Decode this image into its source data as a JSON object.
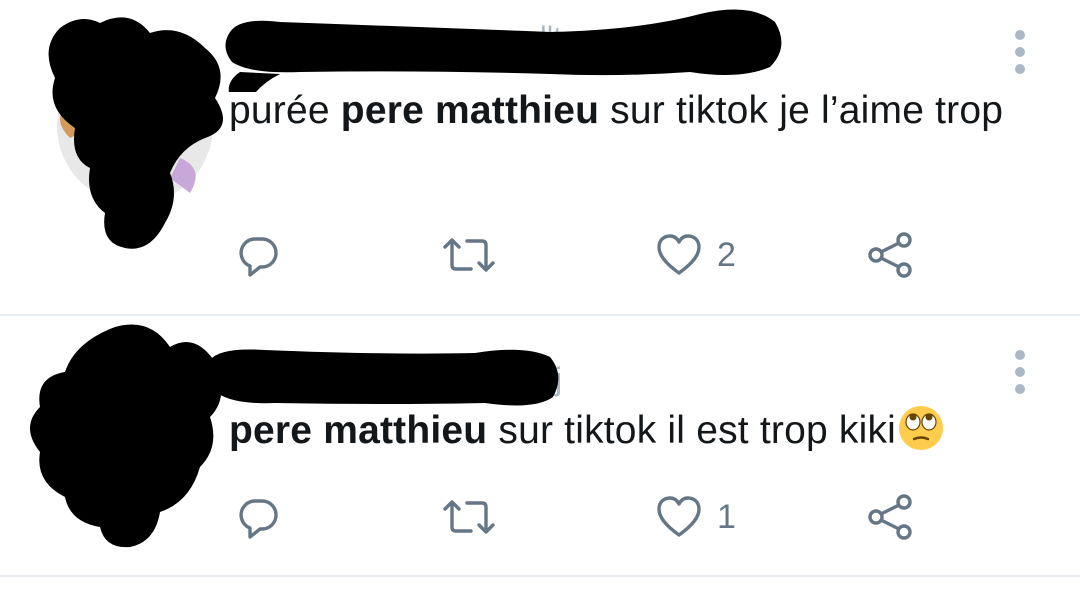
{
  "tweets": [
    {
      "text_parts": [
        {
          "text": "purée ",
          "bold": false
        },
        {
          "text": "pere matthieu",
          "bold": true
        },
        {
          "text": " sur tiktok je l’aime trop",
          "bold": false
        }
      ],
      "actions": {
        "reply_icon": "reply-icon",
        "retweet_icon": "retweet-icon",
        "like_icon": "heart-icon",
        "like_count": "2",
        "share_icon": "share-icon"
      }
    },
    {
      "text_parts": [
        {
          "text": "pere matthieu",
          "bold": true
        },
        {
          "text": " sur tiktok il est trop kiki",
          "bold": false
        }
      ],
      "emoji": "face-with-rolling-eyes",
      "actions": {
        "reply_icon": "reply-icon",
        "retweet_icon": "retweet-icon",
        "like_icon": "heart-icon",
        "like_count": "1",
        "share_icon": "share-icon"
      }
    }
  ],
  "colors": {
    "text": "#14171a",
    "icon": "#657786",
    "more": "#aab8c2",
    "divider": "#e6ecf0",
    "redaction": "#000000"
  }
}
